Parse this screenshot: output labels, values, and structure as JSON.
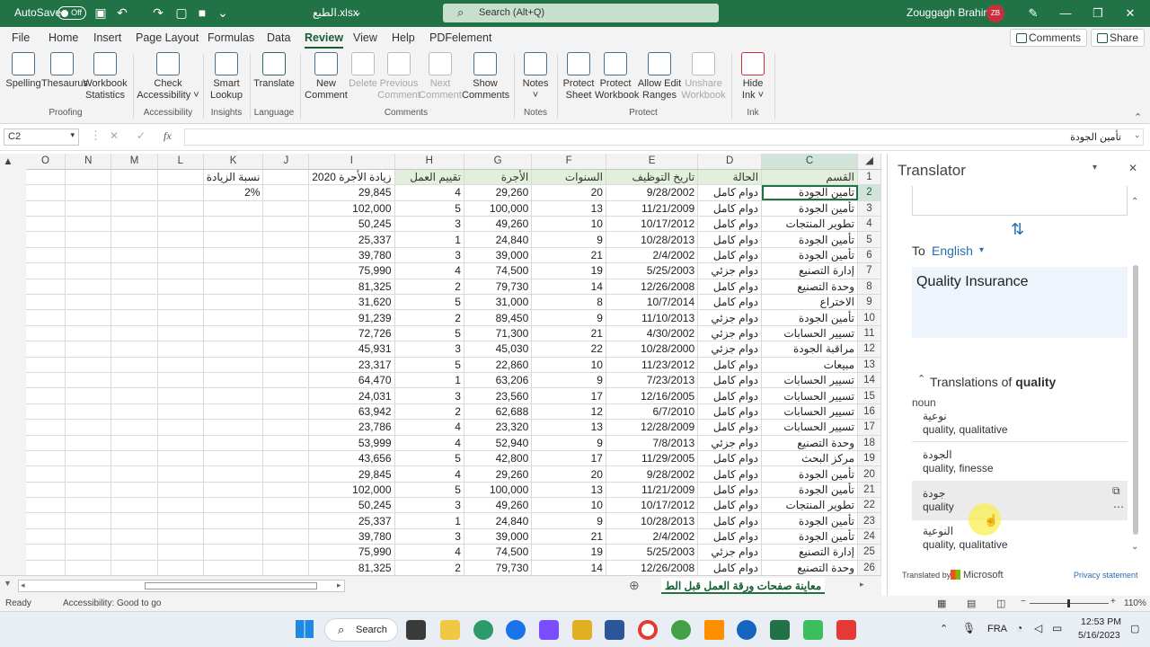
{
  "titlebar": {
    "autosave": "AutoSave",
    "autosave_state": "Off",
    "filename": "الطبع.xlsx",
    "search_placeholder": "Search (Alt+Q)",
    "user": "Zouggagh Brahim",
    "initials": "ZB"
  },
  "tabs": [
    "File",
    "Home",
    "Insert",
    "Page Layout",
    "Formulas",
    "Data",
    "Review",
    "View",
    "Help",
    "PDFelement"
  ],
  "active_tab": "Review",
  "comments_btn": "Comments",
  "share_btn": "Share",
  "ribbon": {
    "spelling": "Spelling",
    "thesaurus": "Thesaurus",
    "workbook": "Workbook",
    "statistics": "Statistics",
    "check": "Check",
    "accessibility": "Accessibility ˅",
    "smart": "Smart",
    "lookup": "Lookup",
    "translate": "Translate",
    "new": "New",
    "comment": "Comment",
    "delete": "Delete",
    "previous": "Previous",
    "next": "Next",
    "show": "Show",
    "comments": "Comments",
    "notes": "Notes",
    "protect": "Protect",
    "sheet": "Sheet",
    "workbook2": "Workbook",
    "allow": "Allow Edit",
    "ranges": "Ranges",
    "unshare": "Unshare",
    "workbook3": "Workbook",
    "hide": "Hide",
    "ink": "Ink ˅",
    "groups": {
      "proofing": "Proofing",
      "accessibility": "Accessibility",
      "insights": "Insights",
      "language": "Language",
      "comments": "Comments",
      "notes": "Notes",
      "protect": "Protect",
      "ink": "Ink"
    }
  },
  "namebox": "C2",
  "fx": "fx",
  "formula": "تأمين الجودة",
  "columns": [
    "O",
    "N",
    "M",
    "L",
    "K",
    "J",
    "I",
    "H",
    "G",
    "F",
    "E",
    "D",
    "C"
  ],
  "header_row": {
    "K": "نسبة الزيادة",
    "I": "زيادة الأجرة 2020",
    "H": "تقييم العمل",
    "G": "الأجرة",
    "F": "السنوات",
    "E": "تاريخ التوظيف",
    "D": "الحالة",
    "C": "القسم"
  },
  "k2": "2%",
  "rows": [
    {
      "n": "2",
      "I": "29,845",
      "H": "4",
      "G": "29,260",
      "F": "20",
      "E": "9/28/2002",
      "D": "دوام كامل",
      "C": "تأمين الجودة"
    },
    {
      "n": "3",
      "I": "102,000",
      "H": "5",
      "G": "100,000",
      "F": "13",
      "E": "11/21/2009",
      "D": "دوام كامل",
      "C": "تأمين الجودة"
    },
    {
      "n": "4",
      "I": "50,245",
      "H": "3",
      "G": "49,260",
      "F": "10",
      "E": "10/17/2012",
      "D": "دوام كامل",
      "C": "تطوير المنتجات"
    },
    {
      "n": "5",
      "I": "25,337",
      "H": "1",
      "G": "24,840",
      "F": "9",
      "E": "10/28/2013",
      "D": "دوام كامل",
      "C": "تأمين الجودة"
    },
    {
      "n": "6",
      "I": "39,780",
      "H": "3",
      "G": "39,000",
      "F": "21",
      "E": "2/4/2002",
      "D": "دوام كامل",
      "C": "تأمين الجودة"
    },
    {
      "n": "7",
      "I": "75,990",
      "H": "4",
      "G": "74,500",
      "F": "19",
      "E": "5/25/2003",
      "D": "دوام جزئي",
      "C": "إدارة التصنيع"
    },
    {
      "n": "8",
      "I": "81,325",
      "H": "2",
      "G": "79,730",
      "F": "14",
      "E": "12/26/2008",
      "D": "دوام كامل",
      "C": "وحدة التصنيع"
    },
    {
      "n": "9",
      "I": "31,620",
      "H": "5",
      "G": "31,000",
      "F": "8",
      "E": "10/7/2014",
      "D": "دوام كامل",
      "C": "الاختراع"
    },
    {
      "n": "10",
      "I": "91,239",
      "H": "2",
      "G": "89,450",
      "F": "9",
      "E": "11/10/2013",
      "D": "دوام جزئي",
      "C": "تأمين الجودة"
    },
    {
      "n": "11",
      "I": "72,726",
      "H": "5",
      "G": "71,300",
      "F": "21",
      "E": "4/30/2002",
      "D": "دوام جزئي",
      "C": "تسيير الحسابات"
    },
    {
      "n": "12",
      "I": "45,931",
      "H": "3",
      "G": "45,030",
      "F": "22",
      "E": "10/28/2000",
      "D": "دوام جزئي",
      "C": "مراقبة الجودة"
    },
    {
      "n": "13",
      "I": "23,317",
      "H": "5",
      "G": "22,860",
      "F": "10",
      "E": "11/23/2012",
      "D": "دوام كامل",
      "C": "مبيعات"
    },
    {
      "n": "14",
      "I": "64,470",
      "H": "1",
      "G": "63,206",
      "F": "9",
      "E": "7/23/2013",
      "D": "دوام كامل",
      "C": "تسيير الحسابات"
    },
    {
      "n": "15",
      "I": "24,031",
      "H": "3",
      "G": "23,560",
      "F": "17",
      "E": "12/16/2005",
      "D": "دوام كامل",
      "C": "تسيير الحسابات"
    },
    {
      "n": "16",
      "I": "63,942",
      "H": "2",
      "G": "62,688",
      "F": "12",
      "E": "6/7/2010",
      "D": "دوام كامل",
      "C": "تسيير الحسابات"
    },
    {
      "n": "17",
      "I": "23,786",
      "H": "4",
      "G": "23,320",
      "F": "13",
      "E": "12/28/2009",
      "D": "دوام كامل",
      "C": "تسيير الحسابات"
    },
    {
      "n": "18",
      "I": "53,999",
      "H": "4",
      "G": "52,940",
      "F": "9",
      "E": "7/8/2013",
      "D": "دوام جزئي",
      "C": "وحدة التصنيع"
    },
    {
      "n": "19",
      "I": "43,656",
      "H": "5",
      "G": "42,800",
      "F": "17",
      "E": "11/29/2005",
      "D": "دوام كامل",
      "C": "مركز البحث"
    },
    {
      "n": "20",
      "I": "29,845",
      "H": "4",
      "G": "29,260",
      "F": "20",
      "E": "9/28/2002",
      "D": "دوام كامل",
      "C": "تأمين الجودة"
    },
    {
      "n": "21",
      "I": "102,000",
      "H": "5",
      "G": "100,000",
      "F": "13",
      "E": "11/21/2009",
      "D": "دوام كامل",
      "C": "تأمين الجودة"
    },
    {
      "n": "22",
      "I": "50,245",
      "H": "3",
      "G": "49,260",
      "F": "10",
      "E": "10/17/2012",
      "D": "دوام كامل",
      "C": "تطوير المنتجات"
    },
    {
      "n": "23",
      "I": "25,337",
      "H": "1",
      "G": "24,840",
      "F": "9",
      "E": "10/28/2013",
      "D": "دوام كامل",
      "C": "تأمين الجودة"
    },
    {
      "n": "24",
      "I": "39,780",
      "H": "3",
      "G": "39,000",
      "F": "21",
      "E": "2/4/2002",
      "D": "دوام كامل",
      "C": "تأمين الجودة"
    },
    {
      "n": "25",
      "I": "75,990",
      "H": "4",
      "G": "74,500",
      "F": "19",
      "E": "5/25/2003",
      "D": "دوام جزئي",
      "C": "إدارة التصنيع"
    },
    {
      "n": "26",
      "I": "81,325",
      "H": "2",
      "G": "79,730",
      "F": "14",
      "E": "12/26/2008",
      "D": "دوام كامل",
      "C": "وحدة التصنيع"
    }
  ],
  "sheet_tab": "معاينة صفحات ورقة العمل قبل الط",
  "translator": {
    "title": "Translator",
    "to": "To",
    "lang": "English",
    "result": "Quality Insurance",
    "translations_of": "Translations of",
    "word": "quality",
    "pos": "noun",
    "items": [
      {
        "ar": "نوعية",
        "en": "quality, qualitative"
      },
      {
        "ar": "الجودة",
        "en": "quality, finesse"
      },
      {
        "ar": "جودة",
        "en": "quality"
      },
      {
        "ar": "النوعية",
        "en": "quality, qualitative"
      }
    ],
    "by": "Translated by",
    "ms": "Microsoft",
    "privacy": "Privacy statement"
  },
  "status": {
    "ready": "Ready",
    "acc": "Accessibility: Good to go",
    "zoom": "110%"
  },
  "taskbar": {
    "search": "Search",
    "lang": "FRA",
    "time": "12:53 PM",
    "date": "5/16/2023"
  },
  "colors": {
    "excel_green": "#217346",
    "accent": "#185c37"
  }
}
